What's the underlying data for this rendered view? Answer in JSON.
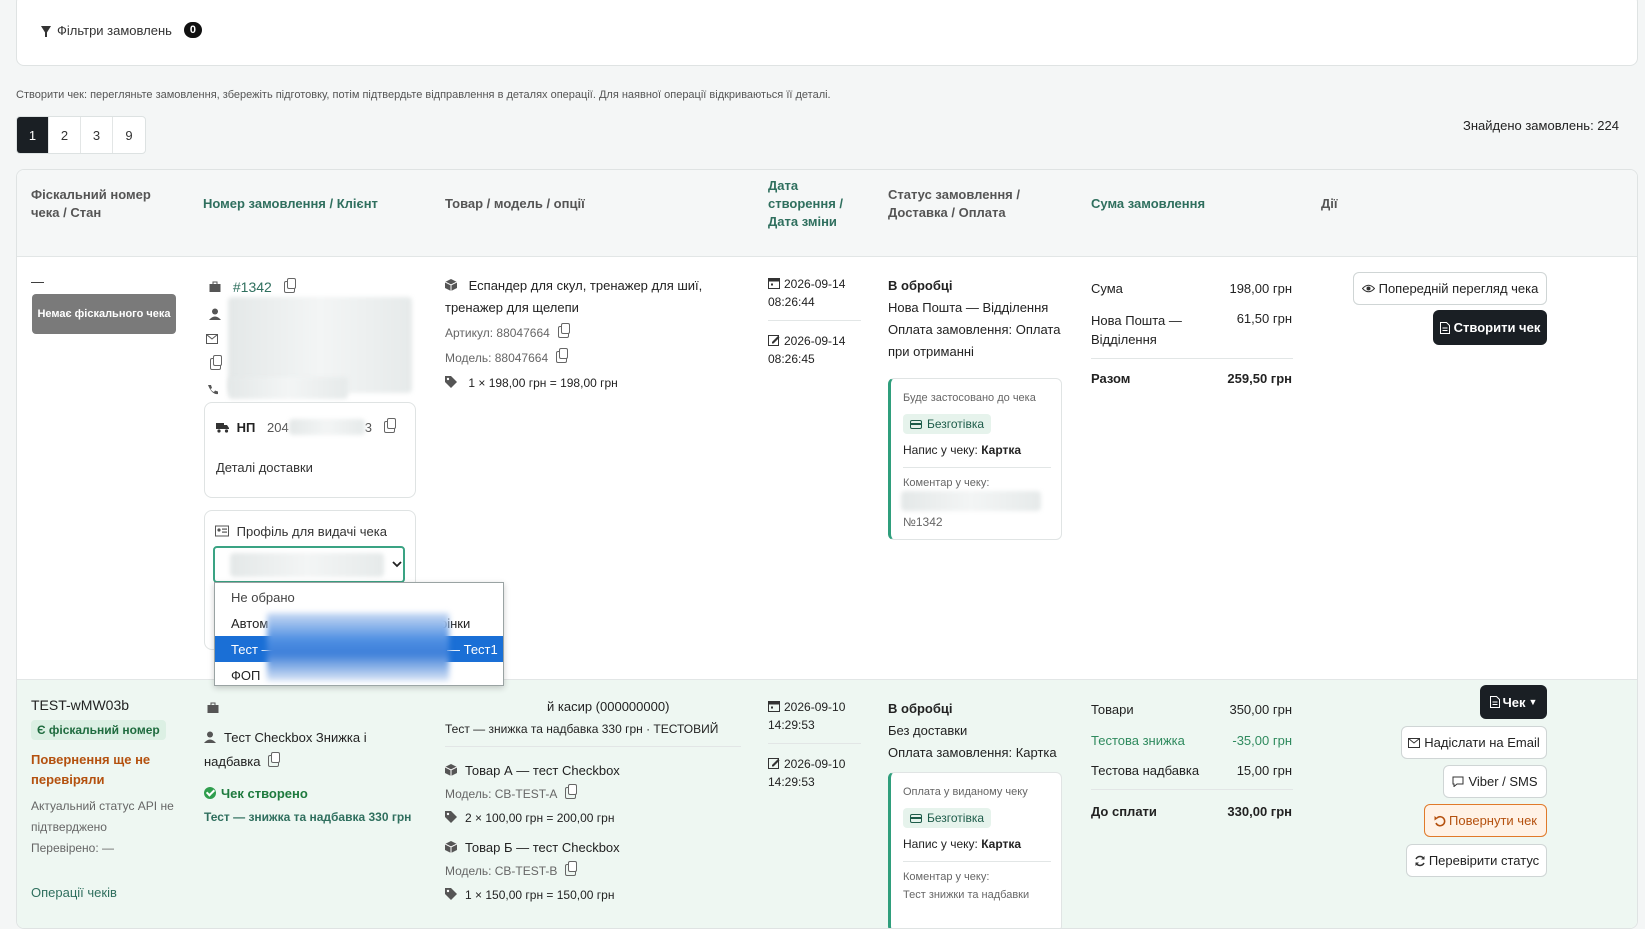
{
  "filters": {
    "label": "Фільтри замовлень",
    "count": "0"
  },
  "hint": "Створити чек: перегляньте замовлення, збережіть підготовку, потім підтвердьте відправлення в деталях операції. Для наявної операції відкриваються її деталі.",
  "pagination": {
    "pages": [
      "1",
      "2",
      "3",
      "9"
    ],
    "active": "1"
  },
  "found": "Знайдено замовлень: 224",
  "columns": {
    "fiscal": "Фіскальний номер чека / Стан",
    "order": "Номер замовлення / Клієнт",
    "goods": "Товар / модель / опції",
    "dates": "Дата створення / Дата зміни",
    "status": "Статус замовлення / Доставка / Оплата",
    "sum": "Сума замовлення",
    "actions": "Дії"
  },
  "order1": {
    "fiscal_dash": "—",
    "fiscal_badge": "Немає фіскального чека",
    "order_number": "#1342",
    "np_label": "НП",
    "np_number_prefix": "204",
    "np_number_suffix": "3",
    "delivery_details": "Деталі доставки",
    "profile_label": "Профіль для видачі чека",
    "profile_options": [
      "Не обрано",
      "Автом",
      "рінки",
      "Тест —",
      "— Тест1",
      "ФОП"
    ],
    "product_name": "Еспандер для скул, тренажер для шиї, тренажер для щелепи",
    "article": "Артикул: 88047664",
    "model": "Модель: 88047664",
    "qty_line": "1 × 198,00 грн = 198,00 грн",
    "created_date": "2026-09-14",
    "created_time": "08:26:44",
    "changed_date": "2026-09-14",
    "changed_time": "08:26:45",
    "status": "В обробці",
    "delivery": "Нова Пошта — Відділення",
    "payment": "Оплата замовлення: Оплата при отриманні",
    "pay_box_caption": "Буде застосовано до чека",
    "pay_tag": "Безготівка",
    "receipt_label_prefix": "Напис у чеку:",
    "receipt_label_value": "Картка",
    "comment_label": "Коментар у чеку:",
    "comment_value": "№1342",
    "sum_label": "Сума",
    "sum_value": "198,00 грн",
    "delivery_sum_label": "Нова Пошта — Відділення",
    "delivery_sum_value": "61,50 грн",
    "total_label": "Разом",
    "total_value": "259,50 грн",
    "btn_preview": "Попередній перегляд чека",
    "btn_create": "Створити чек"
  },
  "order2": {
    "fiscal_number": "TEST-wMW03b",
    "fiscal_badge": "Є фіскальний номер",
    "return_status": "Повернення ще не перевіряли",
    "api_status": "Актуальний статус API не підтверджено",
    "checked": "Перевірено: —",
    "operations_link": "Операції чеків",
    "client": "Тест Checkbox Знижка і надбавка",
    "check_created": "Чек створено",
    "check_name": "Тест — знижка та надбавка 330 грн",
    "cashier": "й касир (000000000)",
    "test_line": "Тест — знижка та надбавка 330 грн · ТЕСТОВИЙ",
    "product_a": "Товар А — тест Checkbox",
    "model_a": "Модель: CB-TEST-A",
    "qty_a": "2 × 100,00 грн = 200,00 грн",
    "product_b": "Товар Б — тест Checkbox",
    "model_b": "Модель: CB-TEST-B",
    "qty_b": "1 × 150,00 грн = 150,00 грн",
    "created_date": "2026-09-10",
    "created_time": "14:29:53",
    "changed_date": "2026-09-10",
    "changed_time": "14:29:53",
    "status": "В обробці",
    "delivery": "Без доставки",
    "payment": "Оплата замовлення: Картка",
    "pay_box_caption": "Оплата у виданому чеку",
    "pay_tag": "Безготівка",
    "receipt_label_prefix": "Напис у чеку:",
    "receipt_label_value": "Картка",
    "comment_label": "Коментар у чеку:",
    "comment_value": "Тест знижки та надбавки",
    "goods_label": "Товари",
    "goods_value": "350,00 грн",
    "discount_label": "Тестова знижка",
    "discount_value": "-35,00 грн",
    "markup_label": "Тестова надбавка",
    "markup_value": "15,00 грн",
    "due_label": "До сплати",
    "due_value": "330,00 грн",
    "btn_check": "Чек",
    "btn_email": "Надіслати на Email",
    "btn_viber": "Viber / SMS",
    "btn_return": "Повернути чек",
    "btn_status": "Перевірити статус"
  },
  "colors": {
    "accent": "#2f6f5e",
    "dark": "#1a1f24",
    "selected_option": "#1a6fd6",
    "return": "#b4510f"
  }
}
